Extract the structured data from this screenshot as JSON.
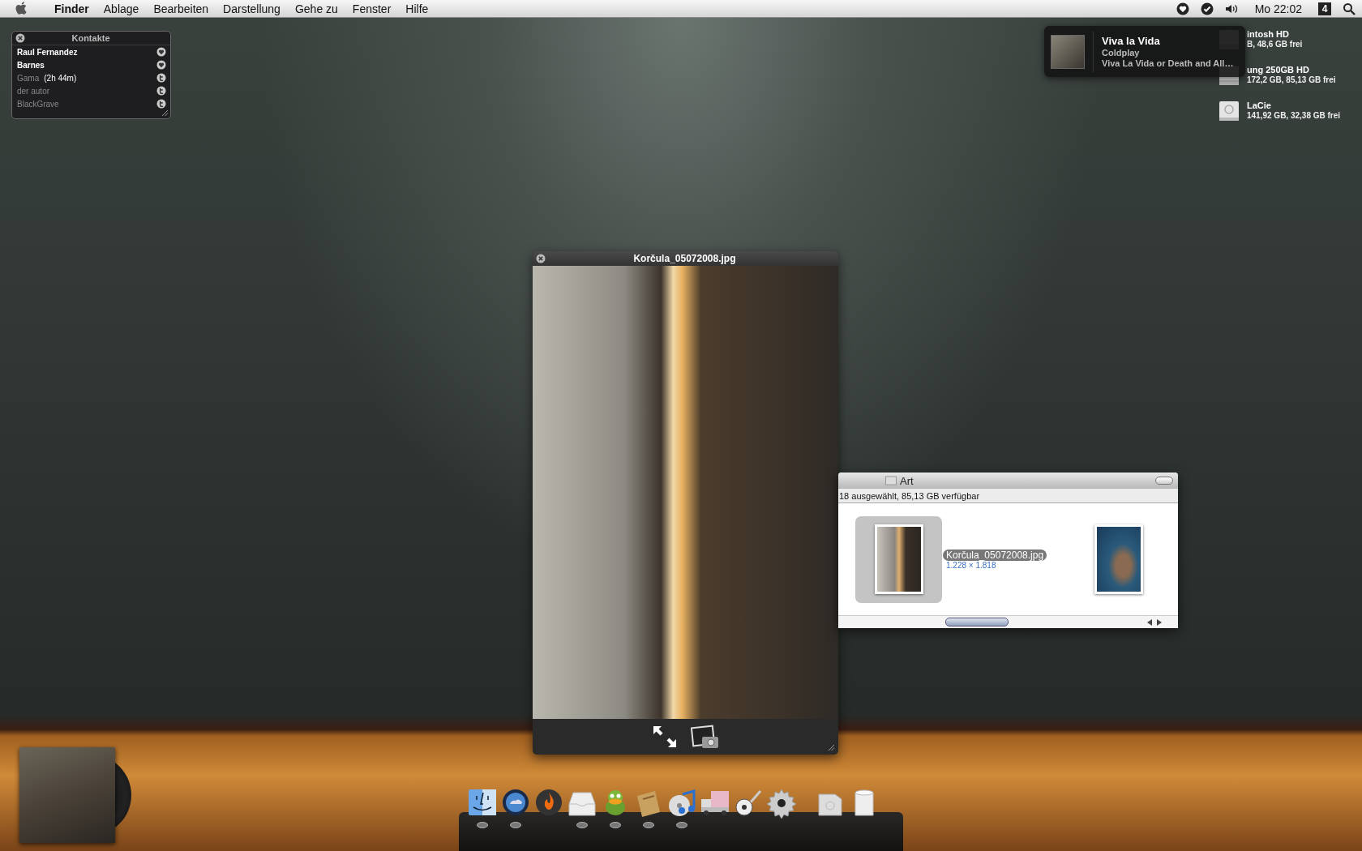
{
  "menu_bar": {
    "app": "Finder",
    "menus": [
      "Ablage",
      "Bearbeiten",
      "Darstellung",
      "Gehe zu",
      "Fenster",
      "Hilfe"
    ],
    "clock": "Mo 22:02",
    "spaces": "4"
  },
  "contacts_widget": {
    "title": "Kontakte",
    "contacts": [
      {
        "name": "Raul Fernandez",
        "online": true,
        "kind": "heart"
      },
      {
        "name": "Barnes",
        "online": true,
        "kind": "heart"
      },
      {
        "name": "Gama",
        "idle_time": "(2h 44m)",
        "online": false,
        "kind": "twitter"
      },
      {
        "name": "der autor",
        "online": false,
        "kind": "twitter"
      },
      {
        "name": "BlackGrave",
        "online": false,
        "kind": "twitter"
      }
    ]
  },
  "notification": {
    "title": "Viva la Vida",
    "artist": "Coldplay",
    "album": "Viva La Vida or Death and All…"
  },
  "drives": [
    {
      "kind": "internal",
      "name": "intosh HD",
      "info": "B, 48,6 GB frei"
    },
    {
      "kind": "internal",
      "name": "ung 250GB HD",
      "info": "172,2 GB, 85,13 GB frei"
    },
    {
      "kind": "firewire",
      "name": "LaCie",
      "info": "141,92 GB, 32,38 GB frei"
    }
  ],
  "quicklook": {
    "title": "Korčula_05072008.jpg"
  },
  "finder_window": {
    "title": "Art",
    "status": "18 ausgewählt, 85,13 GB verfügbar",
    "items": [
      {
        "kind": "alley",
        "name": "Korčula_05072008.jpg",
        "dimensions": "1.228 × 1.818",
        "selected": true
      },
      {
        "kind": "coast",
        "selected": false
      }
    ]
  },
  "dock": {
    "items": [
      {
        "kind": "finder",
        "running": true
      },
      {
        "kind": "globe",
        "running": true
      },
      {
        "kind": "flame",
        "running": false
      },
      {
        "kind": "mail",
        "running": true
      },
      {
        "kind": "duck",
        "running": true
      },
      {
        "kind": "script",
        "running": true
      },
      {
        "kind": "music",
        "running": true
      },
      {
        "kind": "truck",
        "running": false
      },
      {
        "kind": "guitar",
        "running": false
      },
      {
        "kind": "gear",
        "running": false
      },
      {
        "kind": "document",
        "running": false
      },
      {
        "kind": "trash",
        "running": false
      }
    ]
  }
}
